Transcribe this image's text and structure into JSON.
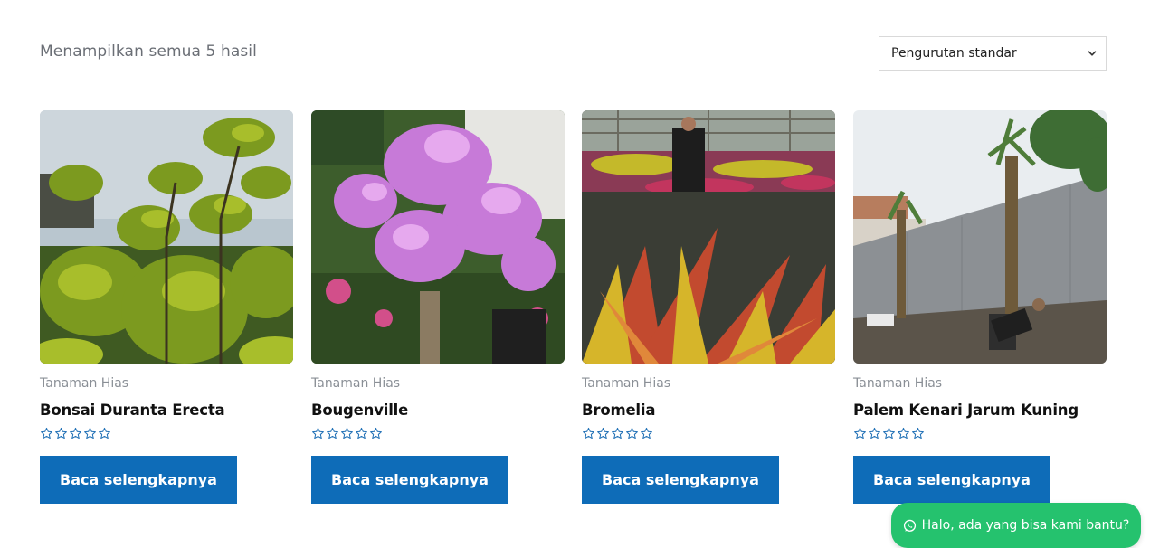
{
  "shop": {
    "result_count": "Menampilkan semua 5 hasil",
    "sort": {
      "selected": "Pengurutan standar"
    }
  },
  "products": [
    {
      "category": "Tanaman Hias",
      "title": "Bonsai Duranta Erecta",
      "button": "Baca selengkapnya",
      "rating": 0,
      "image": "bonsai-duranta-photo"
    },
    {
      "category": "Tanaman Hias",
      "title": "Bougenville",
      "button": "Baca selengkapnya",
      "rating": 0,
      "image": "bougainvillea-photo"
    },
    {
      "category": "Tanaman Hias",
      "title": "Bromelia",
      "button": "Baca selengkapnya",
      "rating": 0,
      "image": "bromeliad-nursery-photo"
    },
    {
      "category": "Tanaman Hias",
      "title": "Palem Kenari Jarum Kuning",
      "button": "Baca selengkapnya",
      "rating": 0,
      "image": "palm-planting-photo"
    }
  ],
  "chat_widget": {
    "label": "Halo, ada yang bisa kami bantu?",
    "icon": "whatsapp-icon"
  },
  "colors": {
    "button": "#0e6cb8",
    "chat": "#25c26e",
    "star": "#1f6fb5",
    "muted": "#8a8f96"
  }
}
